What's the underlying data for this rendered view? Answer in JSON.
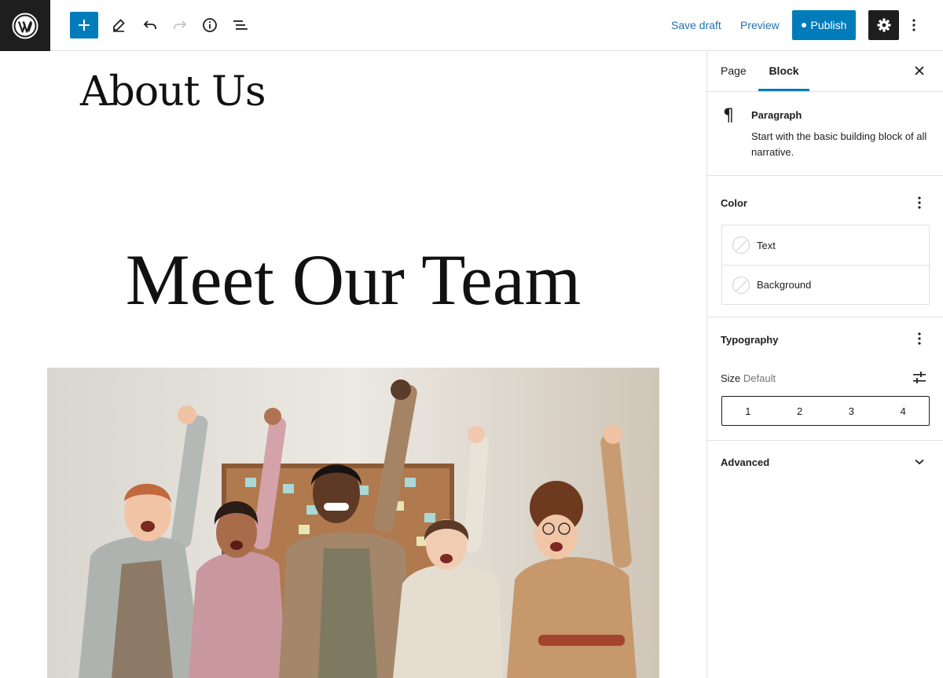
{
  "toolbar": {
    "logo_icon": "wordpress-logo-icon",
    "add_icon": "plus-icon",
    "tools_icon": "pencil-icon",
    "undo_icon": "undo-icon",
    "redo_icon": "redo-icon",
    "info_icon": "info-icon",
    "list_view_icon": "list-view-icon",
    "save_draft": "Save draft",
    "preview": "Preview",
    "publish": "Publish",
    "settings_icon": "gear-icon",
    "more_icon": "more-vertical-icon",
    "accent": "#007cba"
  },
  "canvas": {
    "page_title": "About Us",
    "heading": "Meet Our Team",
    "image_subject": "team-photo"
  },
  "sidebar": {
    "tabs": [
      {
        "label": "Page",
        "active": false
      },
      {
        "label": "Block",
        "active": true
      }
    ],
    "close_icon": "close-icon",
    "block": {
      "icon": "paragraph-icon",
      "name": "Paragraph",
      "description": "Start with the basic building block of all narrative."
    },
    "color": {
      "title": "Color",
      "items": [
        {
          "label": "Text"
        },
        {
          "label": "Background"
        }
      ]
    },
    "typography": {
      "title": "Typography",
      "size_label": "Size",
      "size_value": "Default",
      "size_options": [
        "1",
        "2",
        "3",
        "4"
      ]
    },
    "advanced": {
      "title": "Advanced"
    }
  }
}
